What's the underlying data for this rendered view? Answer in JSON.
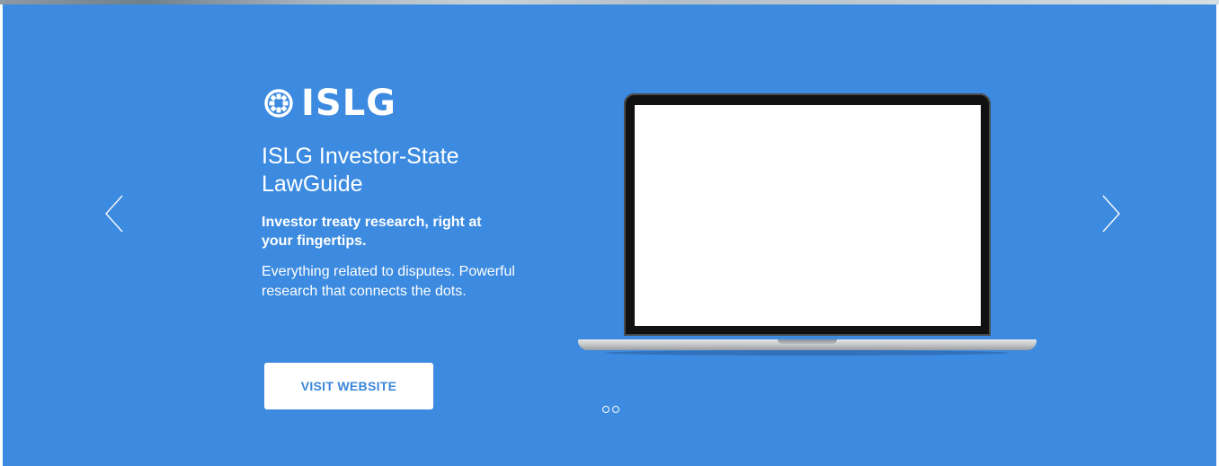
{
  "slide": {
    "brand": "ISLG",
    "brand_icon": "gear-icon",
    "product_title": "ISLG Investor-State LawGuide",
    "tagline": "Investor treaty research, right at your fingertips.",
    "description": "Everything related to disputes. Powerful research that connects the dots.",
    "button_label": "VISIT WEBSITE"
  },
  "navigation": {
    "prev_icon": "chevron-left-icon",
    "next_icon": "chevron-right-icon",
    "dot_count": 2,
    "active_dot": 0
  },
  "colors": {
    "background": "#3c8be0",
    "button_bg": "#ffffff",
    "button_text": "#3a86d9",
    "text": "#ffffff"
  }
}
